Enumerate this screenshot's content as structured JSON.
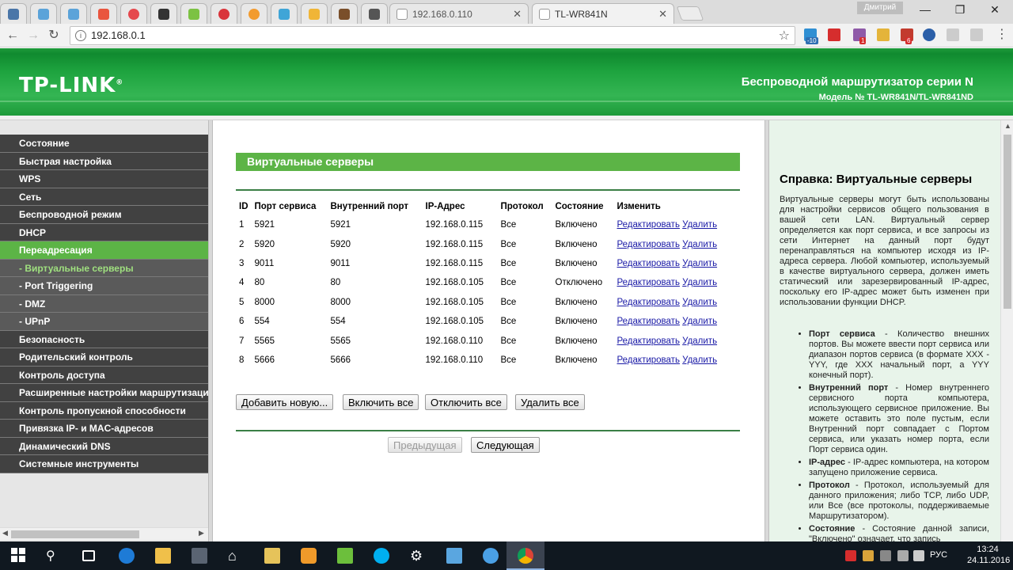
{
  "browser": {
    "tabs": [
      {
        "title": "192.168.0.110",
        "icon": "page-icon"
      },
      {
        "title": "TL-WR841N",
        "icon": "page-icon",
        "active": true
      }
    ],
    "user_name": "Дмитрий",
    "url": "192.168.0.1",
    "extension_badges": [
      "-10",
      "1",
      "6"
    ],
    "window_controls": {
      "minimize": "—",
      "maximize": "❐",
      "close": "✕"
    }
  },
  "banner": {
    "logo": "TP-LINK",
    "logo_mark": "®",
    "title": "Беспроводной маршрутизатор серии N",
    "model": "Модель № TL-WR841N/TL-WR841ND",
    "colors": {
      "green": "#1ea43f",
      "menu_dark": "#414141",
      "menu_active": "#5cb446"
    }
  },
  "sidebar": {
    "items": [
      {
        "label": "Состояние"
      },
      {
        "label": "Быстрая настройка"
      },
      {
        "label": "WPS"
      },
      {
        "label": "Сеть"
      },
      {
        "label": "Беспроводной режим"
      },
      {
        "label": "DHCP"
      },
      {
        "label": "Переадресация",
        "active": true
      },
      {
        "label": "- Виртуальные серверы",
        "sub": true,
        "active": true
      },
      {
        "label": "- Port Triggering",
        "sub": true
      },
      {
        "label": "- DMZ",
        "sub": true
      },
      {
        "label": "- UPnP",
        "sub": true
      },
      {
        "label": "Безопасность"
      },
      {
        "label": "Родительский контроль"
      },
      {
        "label": "Контроль доступа"
      },
      {
        "label": "Расширенные настройки маршрутизации"
      },
      {
        "label": "Контроль пропускной способности"
      },
      {
        "label": "Привязка IP- и MAC-адресов"
      },
      {
        "label": "Динамический DNS"
      },
      {
        "label": "Системные инструменты"
      }
    ]
  },
  "main": {
    "section_title": "Виртуальные серверы",
    "columns": [
      "ID",
      "Порт сервиса",
      "Внутренний порт",
      "IP-Адрес",
      "Протокол",
      "Состояние",
      "Изменить"
    ],
    "rows": [
      {
        "id": "1",
        "service_port": "5921",
        "internal_port": "5921",
        "ip": "192.168.0.115",
        "protocol": "Все",
        "status": "Включено"
      },
      {
        "id": "2",
        "service_port": "5920",
        "internal_port": "5920",
        "ip": "192.168.0.115",
        "protocol": "Все",
        "status": "Включено"
      },
      {
        "id": "3",
        "service_port": "9011",
        "internal_port": "9011",
        "ip": "192.168.0.115",
        "protocol": "Все",
        "status": "Включено"
      },
      {
        "id": "4",
        "service_port": "80",
        "internal_port": "80",
        "ip": "192.168.0.105",
        "protocol": "Все",
        "status": "Отключено"
      },
      {
        "id": "5",
        "service_port": "8000",
        "internal_port": "8000",
        "ip": "192.168.0.105",
        "protocol": "Все",
        "status": "Включено"
      },
      {
        "id": "6",
        "service_port": "554",
        "internal_port": "554",
        "ip": "192.168.0.105",
        "protocol": "Все",
        "status": "Включено"
      },
      {
        "id": "7",
        "service_port": "5565",
        "internal_port": "5565",
        "ip": "192.168.0.110",
        "protocol": "Все",
        "status": "Включено"
      },
      {
        "id": "8",
        "service_port": "5666",
        "internal_port": "5666",
        "ip": "192.168.0.110",
        "protocol": "Все",
        "status": "Включено"
      }
    ],
    "edit_label": "Редактировать",
    "delete_label": "Удалить",
    "buttons": {
      "add": "Добавить новую...",
      "enable_all": "Включить все",
      "disable_all": "Отключить все",
      "delete_all": "Удалить все",
      "prev": "Предыдущая",
      "next": "Следующая"
    }
  },
  "help": {
    "title": "Справка: Виртуальные серверы",
    "intro": "Виртуальные серверы могут быть использованы для настройки сервисов общего пользования в вашей сети LAN. Виртуальный сервер определяется как порт сервиса, и все запросы из сети Интернет на данный порт будут перенаправляться на компьютер исходя из IP-адреса сервера. Любой компьютер, используемый в качестве виртуального сервера, должен иметь статический или зарезервированный IP-адрес, поскольку его IP-адрес может быть изменен при использовании функции DHCP.",
    "items": [
      {
        "term": "Порт сервиса",
        "text": " - Количество внешних портов. Вы можете ввести порт сервиса или диапазон портов сервиса (в формате XXX - YYY, где XXX начальный порт, а YYY конечный порт)."
      },
      {
        "term": "Внутренний порт",
        "text": " - Номер внутреннего сервисного порта компьютера, использующего сервисное приложение. Вы можете оставить это поле пустым, если Внутренний порт совпадает с Портом сервиса, или указать номер порта, если Порт сервиса один."
      },
      {
        "term": "IP-адрес",
        "text": " - IP-адрес компьютера, на котором запущено приложение сервиса."
      },
      {
        "term": "Протокол",
        "text": " - Протокол, используемый для данного приложения; либо TCP, либо UDP, или Все (все протоколы, поддерживаемые Маршрутизатором)."
      },
      {
        "term": "Состояние",
        "text": " - Состояние данной записи, \"Включено\" означает, что запись"
      }
    ]
  },
  "taskbar": {
    "language": "РУС",
    "time": "13:24",
    "date": "24.11.2016"
  }
}
